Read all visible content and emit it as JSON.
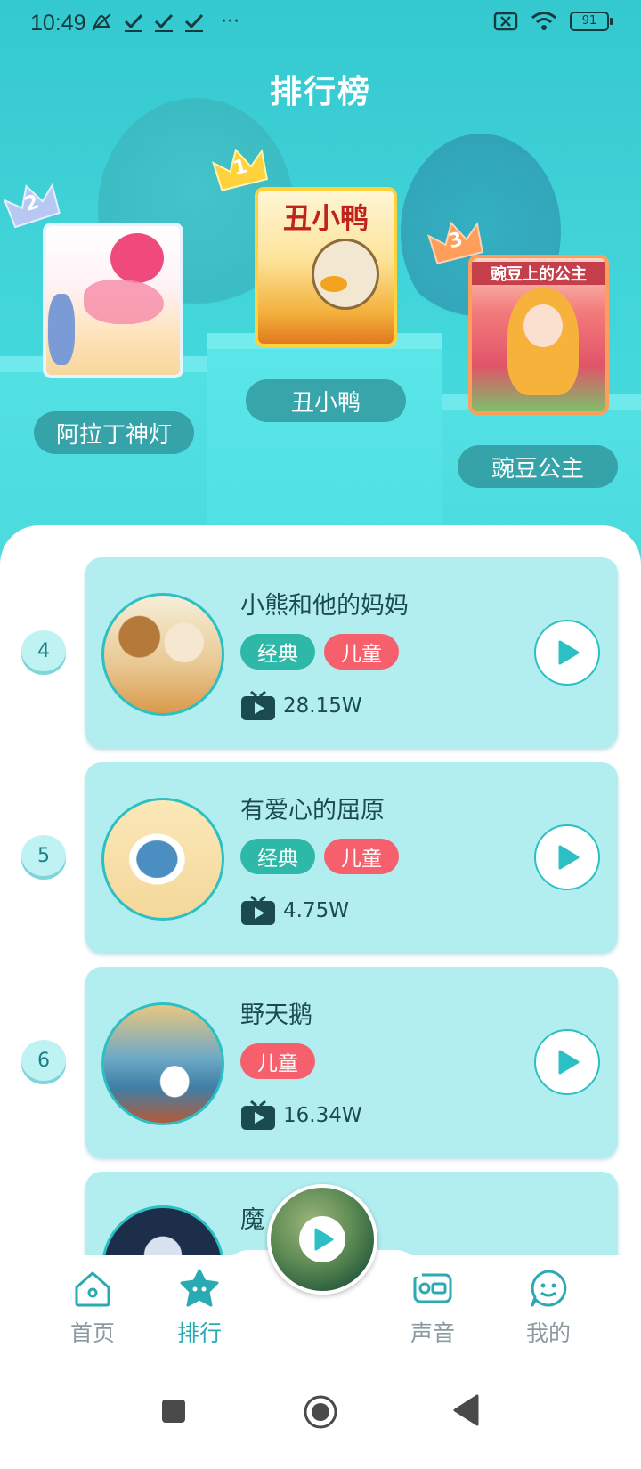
{
  "status_bar": {
    "time": "10:49",
    "left_icons": [
      "mute-icon",
      "check-icon",
      "check-icon",
      "check-icon",
      "more-icon"
    ],
    "right_icons": [
      "no-sim-icon",
      "wifi-icon"
    ],
    "battery": "91",
    "more_dots": "···"
  },
  "page_title": "排行榜",
  "podium": [
    {
      "rank": "2",
      "name": "阿拉丁神灯",
      "crown_color": "#b7c9f2"
    },
    {
      "rank": "1",
      "name": "丑小鸭",
      "crown_color": "#ffd23b",
      "cover_text": "丑小鸭"
    },
    {
      "rank": "3",
      "name": "豌豆公主",
      "crown_color": "#ff9e5a",
      "cover_text": "豌豆上的公主"
    }
  ],
  "list": [
    {
      "rank": "4",
      "title": "小熊和他的妈妈",
      "tags": [
        "经典",
        "儿童"
      ],
      "plays": "28.15W"
    },
    {
      "rank": "5",
      "title": "有爱心的屈原",
      "tags": [
        "经典",
        "儿童"
      ],
      "plays": "4.75W"
    },
    {
      "rank": "6",
      "title": "野天鹅",
      "tags": [
        "儿童"
      ],
      "plays": "16.34W"
    },
    {
      "rank": "",
      "title": "魔",
      "tags": [
        "典",
        "启"
      ],
      "plays": ""
    }
  ],
  "bottom_nav": {
    "home": "首页",
    "rank": "排行",
    "sound": "声音",
    "mine": "我的"
  },
  "colors": {
    "accent": "#2aaab2",
    "classic_tag": "#2db8a7",
    "child_tag": "#f5606c",
    "card_bg": "#b2eef0"
  }
}
